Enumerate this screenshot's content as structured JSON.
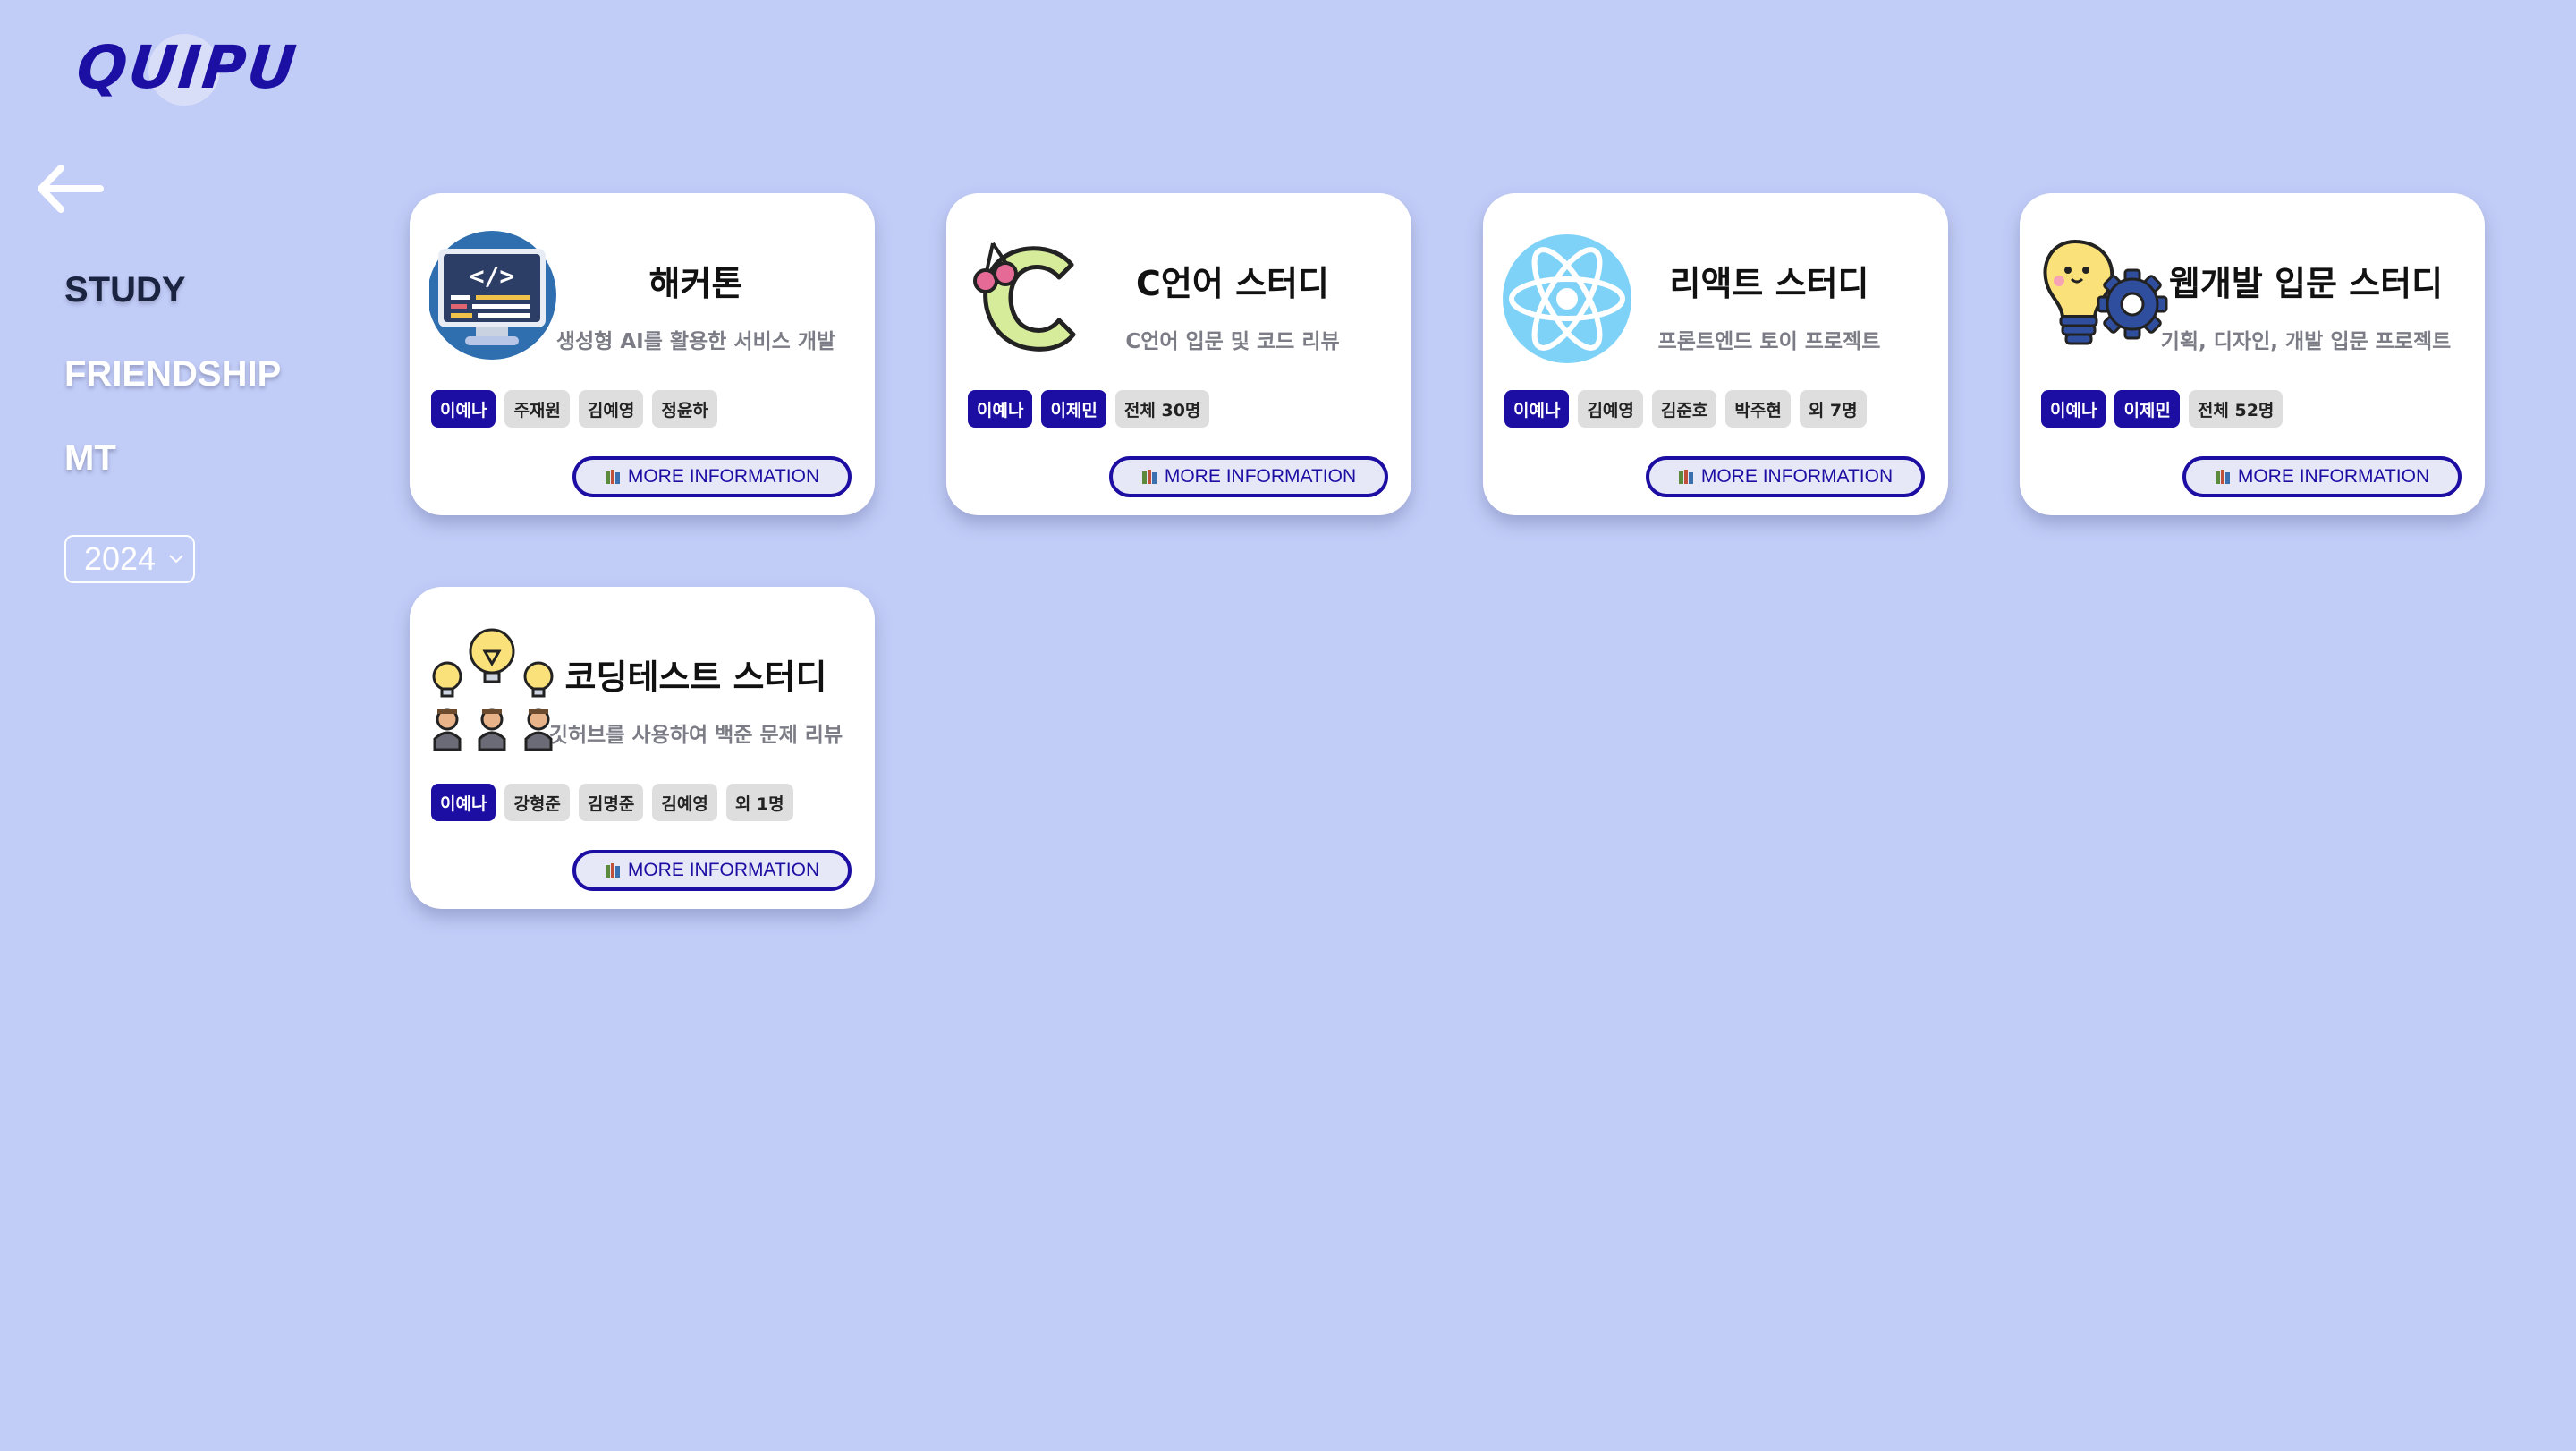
{
  "app": {
    "logo_text": "QUIPU"
  },
  "nav": {
    "items": [
      "STUDY",
      "FRIENDSHIP",
      "MT"
    ],
    "active": "STUDY"
  },
  "year_select": {
    "value": "2024"
  },
  "colors": {
    "background": "#c1ccf7",
    "accent": "#1d0ea3",
    "card": "#ffffff",
    "tag": "#dedede"
  },
  "cards": [
    {
      "title": "해커톤",
      "desc": "생성형 AI를 활용한 서비스 개발",
      "icon": "code-monitor-icon",
      "tags": [
        "이예나",
        "주재원",
        "김예영",
        "정윤하"
      ],
      "lead_tags": 1,
      "button": "MORE INFORMATION"
    },
    {
      "title": "C언어 스터디",
      "desc": "C언어 입문 및 코드 리뷰",
      "icon": "letter-c-cherry-icon",
      "tags": [
        "이예나",
        "이제민",
        "전체 30명"
      ],
      "lead_tags": 2,
      "button": "MORE INFORMATION"
    },
    {
      "title": "리액트 스터디",
      "desc": "프론트엔드 토이 프로젝트",
      "icon": "react-atom-icon",
      "tags": [
        "이예나",
        "김예영",
        "김준호",
        "박주현",
        "외 7명"
      ],
      "lead_tags": 1,
      "button": "MORE INFORMATION"
    },
    {
      "title": "웹개발 입문 스터디",
      "desc": "기획, 디자인, 개발 입문 프로젝트",
      "icon": "lightbulb-gear-icon",
      "tags": [
        "이예나",
        "이제민",
        "전체 52명"
      ],
      "lead_tags": 2,
      "button": "MORE INFORMATION"
    },
    {
      "title": "코딩테스트 스터디",
      "desc": "깃허브를 사용하여 백준 문제 리뷰",
      "icon": "team-ideas-icon",
      "tags": [
        "이예나",
        "강형준",
        "김명준",
        "김예영",
        "외 1명"
      ],
      "lead_tags": 1,
      "button": "MORE INFORMATION"
    }
  ]
}
